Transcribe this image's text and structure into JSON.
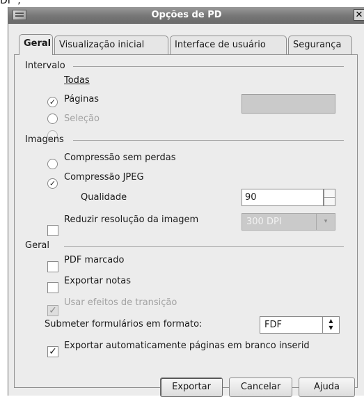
{
  "window": {
    "title": "Opções de PD",
    "close_glyph": "✕",
    "close_icon": "close-icon",
    "app_icon": "document-pdf-icon"
  },
  "behind_text": "DF\";",
  "tabs": [
    {
      "label": "Geral",
      "active": true
    },
    {
      "label": "Visualização inicial",
      "active": false
    },
    {
      "label": "Interface de usuário",
      "active": false
    },
    {
      "label": "Segurança",
      "active": false
    }
  ],
  "intervalo": {
    "heading": "Intervalo",
    "todas": {
      "label": "Todas",
      "selected": true
    },
    "paginas": {
      "label": "Páginas",
      "selected": false,
      "value": ""
    },
    "selecao": {
      "label": "Seleção",
      "selected": false,
      "disabled": true
    }
  },
  "imagens": {
    "heading": "Imagens",
    "lossless": {
      "label": "Compressão sem perdas",
      "selected": false
    },
    "jpeg": {
      "label": "Compressão JPEG",
      "selected": true
    },
    "quality": {
      "label": "Qualidade",
      "value": "90"
    },
    "reduce": {
      "label": "Reduzir resolução da imagem",
      "checked": false,
      "dpi": "300 DPI"
    }
  },
  "geral": {
    "heading": "Geral",
    "tagged": {
      "label": "PDF marcado",
      "checked": false
    },
    "notes": {
      "label": "Exportar notas",
      "checked": false
    },
    "transitions": {
      "label": "Usar efeitos de transição",
      "checked": true,
      "disabled": true
    },
    "submit": {
      "label": "Submeter formulários em formato:",
      "value": "FDF"
    },
    "blank": {
      "label": "Exportar automaticamente páginas em branco inserid",
      "checked": true
    }
  },
  "buttons": {
    "export": "Exportar",
    "cancel": "Cancelar",
    "help": "Ajuda"
  },
  "glyphs": {
    "check": "✓",
    "radio_dot": "✓",
    "up": "▲",
    "down": "▼",
    "caret": "▾"
  }
}
